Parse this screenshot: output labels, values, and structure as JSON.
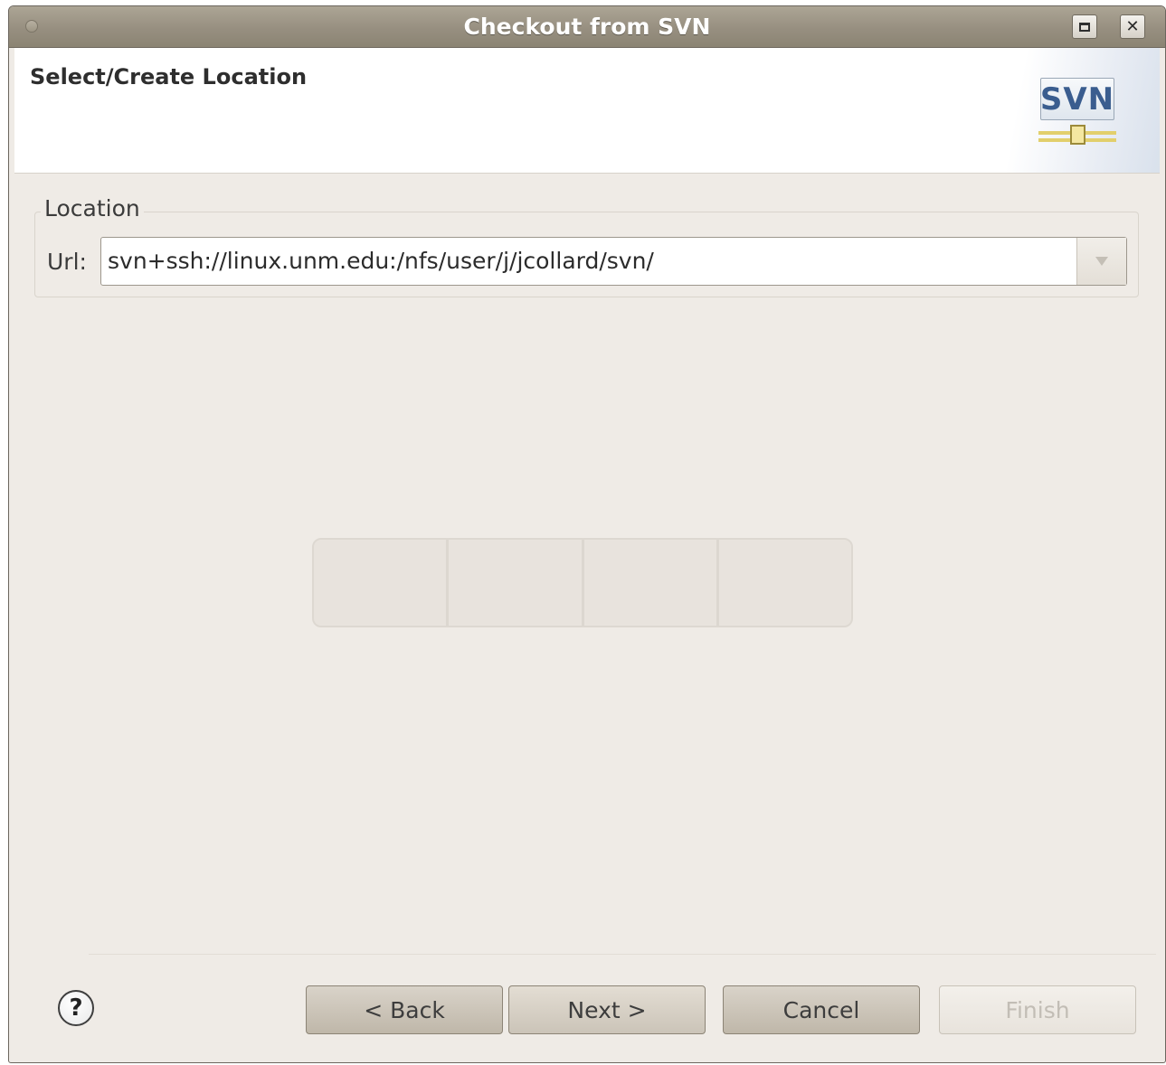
{
  "window": {
    "title": "Checkout from SVN"
  },
  "header": {
    "title": "Select/Create Location",
    "logo_text": "SVN"
  },
  "location": {
    "group_label": "Location",
    "url_label": "Url:",
    "url_value": "svn+ssh://linux.unm.edu:/nfs/user/j/jcollard/svn/"
  },
  "progress": {
    "segments": 4
  },
  "buttons": {
    "help": "?",
    "back": "< Back",
    "next": "Next >",
    "cancel": "Cancel",
    "finish": "Finish"
  },
  "icons": {
    "window_menu": "circle-icon",
    "maximize": "maximize-icon",
    "close": "close-icon",
    "combo": "chevron-down-icon",
    "help": "help-icon"
  },
  "colors": {
    "titlebar": "#978f80",
    "dialog_background": "#efebe6",
    "svn_blue": "#3a5d8f"
  }
}
